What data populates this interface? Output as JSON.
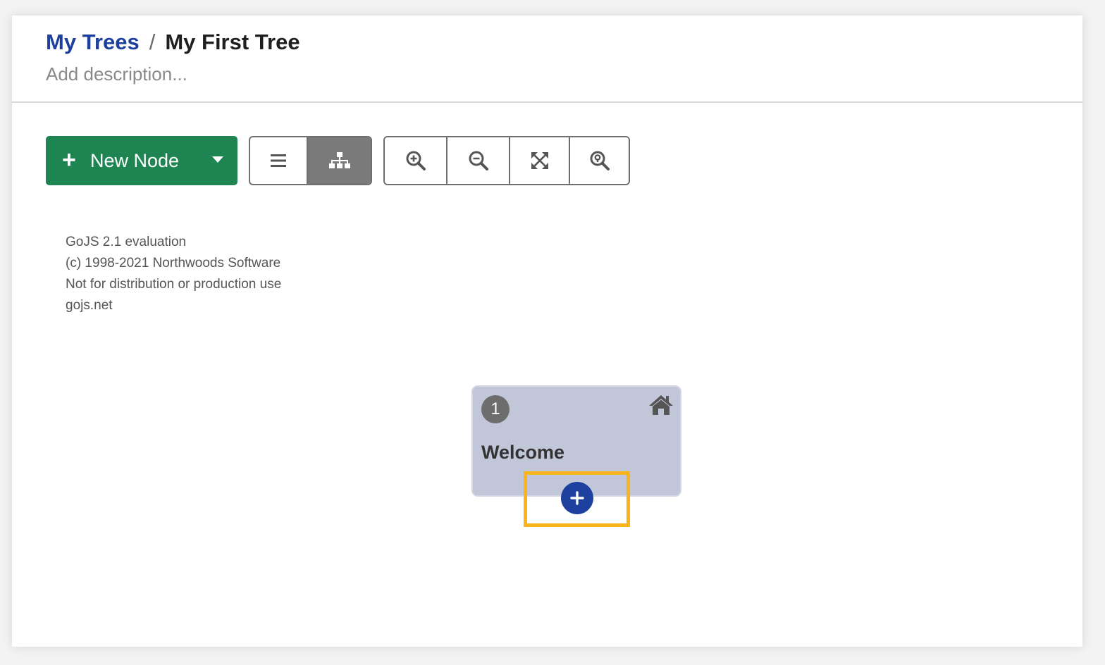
{
  "header": {
    "breadcrumb_root": "My Trees",
    "breadcrumb_separator": "/",
    "breadcrumb_current": "My First Tree",
    "description_placeholder": "Add description..."
  },
  "toolbar": {
    "new_node": {
      "plus_icon": "plus-icon",
      "label": "New Node",
      "dropdown_icon": "caret-down-icon"
    },
    "view_modes": [
      {
        "icon": "list-icon",
        "active": false
      },
      {
        "icon": "tree-hierarchy-icon",
        "active": true
      }
    ],
    "zoom_controls": [
      {
        "icon": "zoom-in-icon"
      },
      {
        "icon": "zoom-out-icon"
      },
      {
        "icon": "fit-to-screen-icon"
      },
      {
        "icon": "zoom-reset-icon"
      }
    ]
  },
  "watermark": {
    "line1": "GoJS 2.1 evaluation",
    "line2": "(c) 1998-2021 Northwoods Software",
    "line3": "Not for distribution or production use",
    "line4": "gojs.net"
  },
  "node": {
    "number": "1",
    "title": "Welcome",
    "home_icon": "home-icon",
    "add_child_icon": "plus-circle-icon"
  },
  "colors": {
    "primary_blue": "#1d3f9e",
    "new_node_green": "#1e8552",
    "node_fill": "#c1c6d9",
    "highlight_orange": "#fab41b",
    "active_view_gray": "#7a7a7a"
  }
}
